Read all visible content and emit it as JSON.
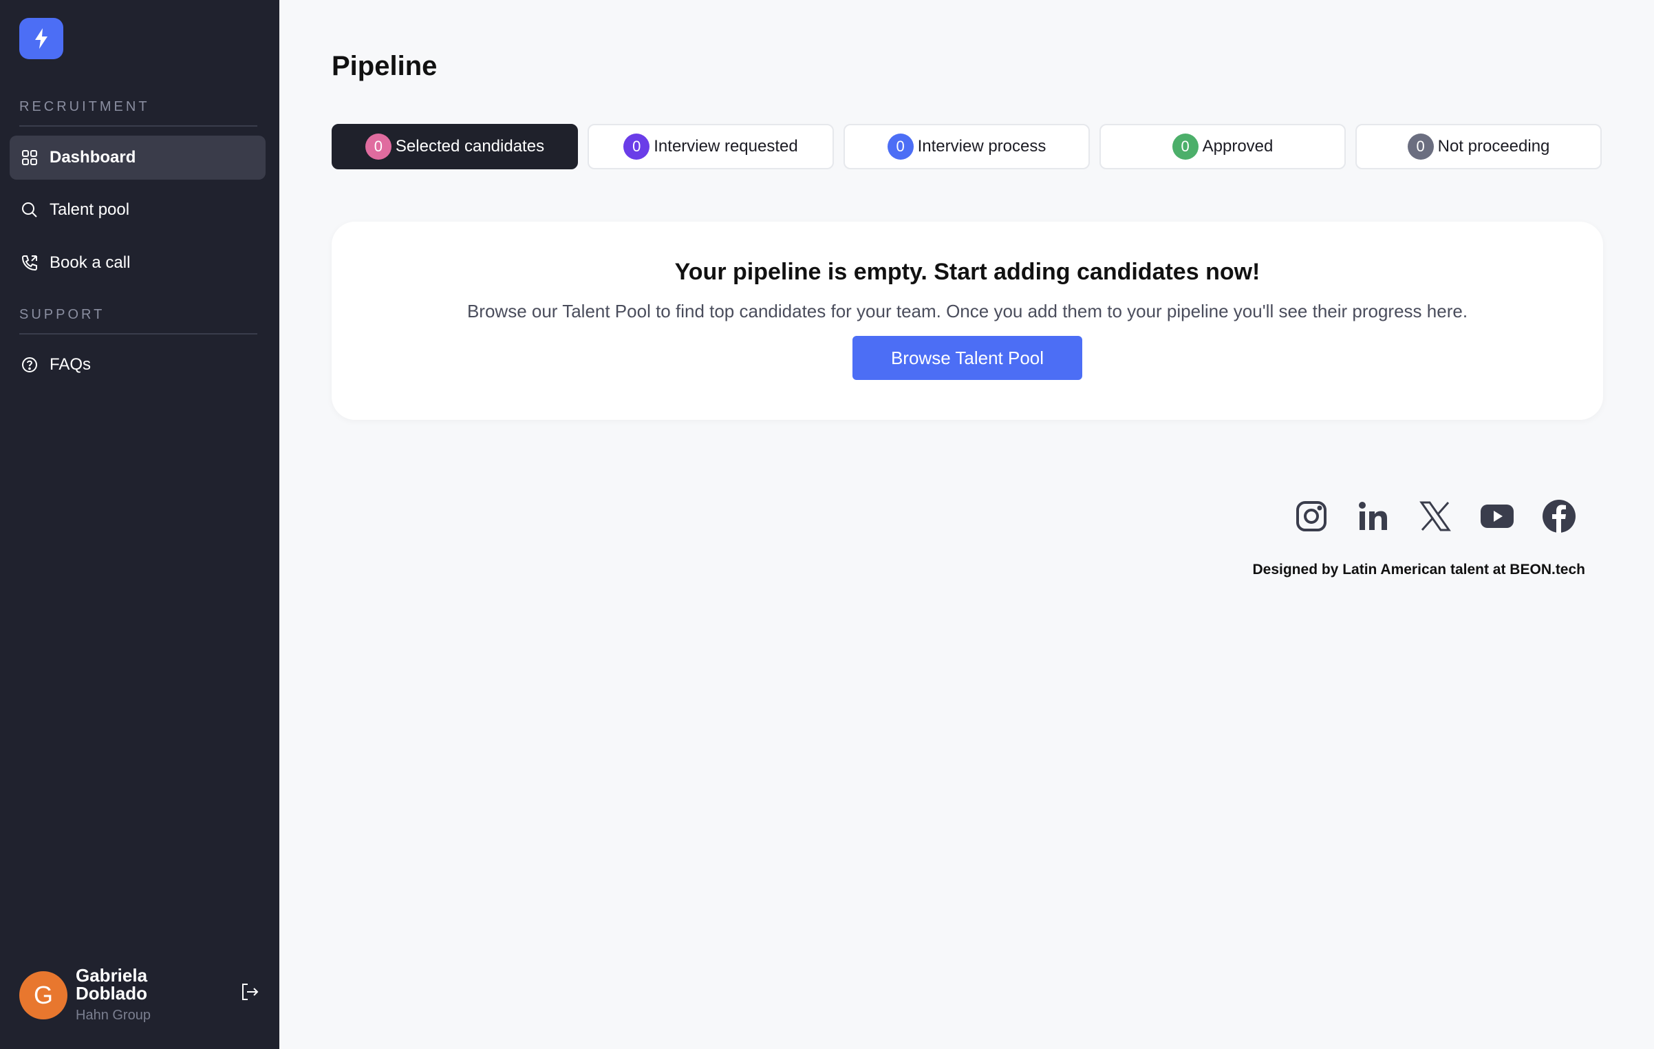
{
  "sidebar": {
    "sections": [
      {
        "title": "RECRUITMENT"
      },
      {
        "title": "SUPPORT"
      }
    ],
    "items": [
      {
        "label": "Dashboard",
        "icon": "grid-icon",
        "active": true
      },
      {
        "label": "Talent pool",
        "icon": "search-icon"
      },
      {
        "label": "Book a call",
        "icon": "phone-icon"
      },
      {
        "label": "FAQs",
        "icon": "help-circle-icon"
      }
    ],
    "user": {
      "initial": "G",
      "name": "Gabriela Doblado",
      "company": "Hahn Group",
      "avatar_color": "#e8772e"
    }
  },
  "main": {
    "title": "Pipeline",
    "tabs": [
      {
        "label": "Selected candidates",
        "count": "0",
        "badge_color": "#e06c9f",
        "active": true
      },
      {
        "label": "Interview requested",
        "count": "0",
        "badge_color": "#6a3de8"
      },
      {
        "label": "Interview process",
        "count": "0",
        "badge_color": "#4c6ef5"
      },
      {
        "label": "Approved",
        "count": "0",
        "badge_color": "#4caf6a"
      },
      {
        "label": "Not proceeding",
        "count": "0",
        "badge_color": "#6b6e80"
      }
    ],
    "empty": {
      "title": "Your pipeline is empty. Start adding candidates now!",
      "description": "Browse our Talent Pool to find top candidates for your team. Once you add them to your pipeline you'll see their progress here.",
      "button": "Browse Talent Pool"
    },
    "socials": [
      "instagram-icon",
      "linkedin-icon",
      "x-icon",
      "youtube-icon",
      "facebook-icon"
    ],
    "credit": "Designed by Latin American talent at BEON.tech"
  },
  "colors": {
    "sidebar_bg": "#20222e",
    "accent": "#4c6ef5"
  }
}
